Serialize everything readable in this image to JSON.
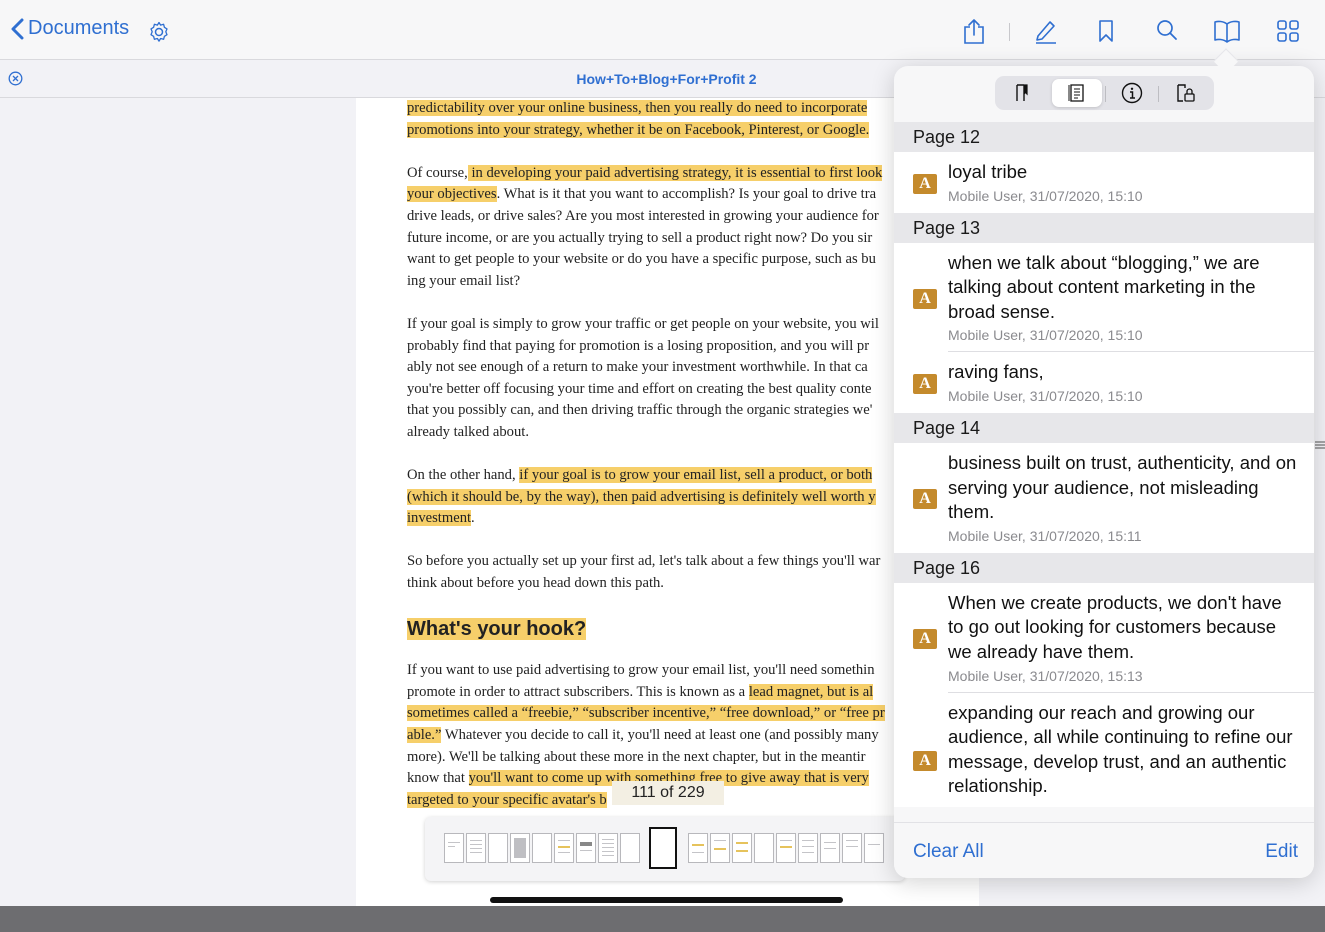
{
  "toolbar": {
    "back_label": "Documents",
    "icons": [
      "settings-icon",
      "share-icon",
      "annotate-icon",
      "bookmark-icon",
      "search-icon",
      "book-icon",
      "grid-icon"
    ]
  },
  "document": {
    "title": "How+To+Blog+For+Profit 2",
    "page_counter": "111 of 229",
    "paragraph1": {
      "l1": "predictability over your online business, then you really do need to incorporate",
      "l2": "promotions into your strategy, whether it be on Facebook, Pinterest, or Google."
    },
    "paragraph2": {
      "l1a": "Of course,",
      "l1b": " in developing your paid advertising strategy, it is essential to first look",
      "l2a": "your objectives",
      "l2b": ". What is it that you want to accomplish? Is your goal to drive tra",
      "l3": "drive leads, or drive sales? Are you most interested in growing your audience for",
      "l4": "future income, or are you actually trying to sell a product right now? Do you sir",
      "l5": "want to get people to your website or do you have a specific purpose, such as bu",
      "l6": "ing your email list?"
    },
    "paragraph3": {
      "l1": "If your goal is simply to grow your traffic or get people on your website, you wil",
      "l2": "probably find that paying for promotion is a losing proposition, and you will pr",
      "l3": "ably not see enough of a return to make your investment worthwhile. In that ca",
      "l4": "you're better off focusing your time and effort on creating the best quality conte",
      "l5": "that you possibly can, and then driving traffic through the organic strategies we'",
      "l6": "already talked about."
    },
    "paragraph4": {
      "l1a": "On the other hand, ",
      "l1b": "if your goal is to grow your email list, sell a product, or both",
      "l2": "(which it should be, by the way), then paid advertising is definitely well worth y",
      "l3": "investment"
    },
    "paragraph5": {
      "l1": "So before you actually set up your first ad, let's talk about a few things you'll war",
      "l2": "think about before you head down this path."
    },
    "heading": "What's your hook?",
    "paragraph6": {
      "l1": "If you want to use paid advertising to grow your email list, you'll need somethin",
      "l2a": "promote in order to attract subscribers. This is known as a ",
      "l2b": "lead magnet, but is al",
      "l3": "sometimes called a “freebie,” “subscriber incentive,” “free download,” or “free pr",
      "l4a": "able.”",
      "l4b": " Whatever you decide to call it, you'll need at least one (and possibly many",
      "l5": "more). We'll be talking about these more in the next chapter, but in the meantir",
      "l6a": "know that ",
      "l6b": "you'll want to come up with something free to give away that is very",
      "l7": "targeted to your specific avatar's b"
    }
  },
  "annotations_panel": {
    "tabs": [
      "bookmarks-tab",
      "annotations-tab",
      "info-tab",
      "clipboard-tab"
    ],
    "active_tab": "annotations-tab",
    "badge_letter": "A",
    "sections": [
      {
        "header": "Page 12",
        "items": [
          {
            "text": "loyal tribe",
            "meta": "Mobile User, 31/07/2020, 15:10"
          }
        ]
      },
      {
        "header": "Page 13",
        "items": [
          {
            "text": "when we talk about “blogging,” we are talking about content marketing in the broad sense.",
            "meta": "Mobile User, 31/07/2020, 15:10"
          },
          {
            "text": "raving fans,",
            "meta": "Mobile User, 31/07/2020, 15:10"
          }
        ]
      },
      {
        "header": "Page 14",
        "items": [
          {
            "text": "business built on trust, authenticity, and on serving your audience, not misleading them.",
            "meta": "Mobile User, 31/07/2020, 15:11"
          }
        ]
      },
      {
        "header": "Page 16",
        "items": [
          {
            "text": "When we create products, we don't have to go out looking for customers because we already have them.",
            "meta": "Mobile User, 31/07/2020, 15:13"
          },
          {
            "text": "expanding our reach and growing our audience, all while continuing to refine our message, develop trust, and an authentic relationship.",
            "meta": ""
          }
        ]
      }
    ],
    "clear_all_label": "Clear All",
    "edit_label": "Edit"
  },
  "colors": {
    "accent": "#2f6fd1",
    "highlight": "#f6cf6a",
    "badge": "#c48a2c"
  }
}
